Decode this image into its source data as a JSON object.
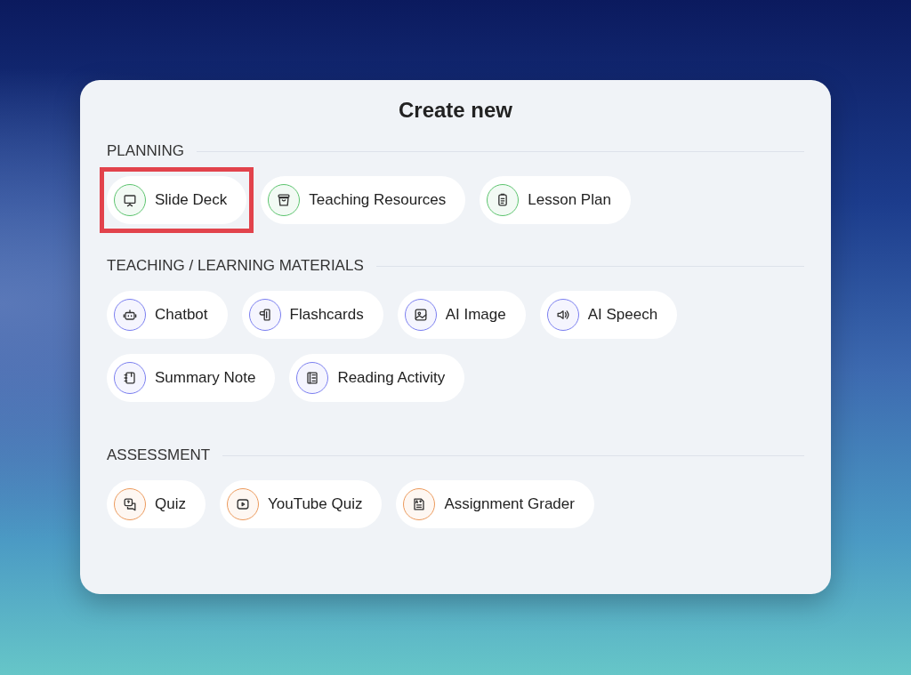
{
  "dialog": {
    "title": "Create new"
  },
  "sections": [
    {
      "label": "PLANNING",
      "color": "#5cc46e",
      "items": [
        {
          "label": "Slide Deck",
          "kind": "presentation",
          "highlighted": true
        },
        {
          "label": "Teaching Resources",
          "kind": "basket",
          "highlighted": false
        },
        {
          "label": "Lesson Plan",
          "kind": "document",
          "highlighted": false
        }
      ]
    },
    {
      "label": "TEACHING / LEARNING MATERIALS",
      "color": "#7b7ff0",
      "items": [
        {
          "label": "Chatbot",
          "kind": "robot",
          "highlighted": false
        },
        {
          "label": "Flashcards",
          "kind": "cards",
          "highlighted": false
        },
        {
          "label": "AI Image",
          "kind": "image",
          "highlighted": false
        },
        {
          "label": "AI Speech",
          "kind": "speaker",
          "highlighted": false
        },
        {
          "label": "Summary Note",
          "kind": "notebook",
          "highlighted": false
        },
        {
          "label": "Reading Activity",
          "kind": "book",
          "highlighted": false
        }
      ]
    },
    {
      "label": "ASSESSMENT",
      "color": "#ec9a5c",
      "items": [
        {
          "label": "Quiz",
          "kind": "chat",
          "highlighted": false
        },
        {
          "label": "YouTube Quiz",
          "kind": "video",
          "highlighted": false
        },
        {
          "label": "Assignment Grader",
          "kind": "graded",
          "highlighted": false
        }
      ]
    }
  ]
}
